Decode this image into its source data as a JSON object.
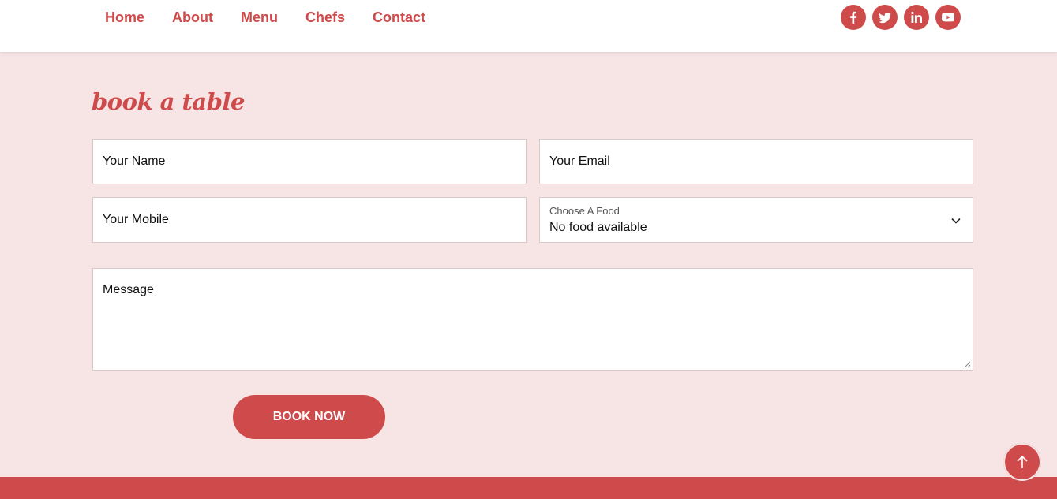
{
  "nav": {
    "items": [
      {
        "label": "Home"
      },
      {
        "label": "About"
      },
      {
        "label": "Menu"
      },
      {
        "label": "Chefs"
      },
      {
        "label": "Contact"
      }
    ]
  },
  "socials": [
    "facebook-icon",
    "twitter-icon",
    "linkedin-icon",
    "youtube-icon"
  ],
  "section": {
    "title": "book a table"
  },
  "form": {
    "name_placeholder": "Your Name",
    "email_placeholder": "Your Email",
    "mobile_placeholder": "Your Mobile",
    "food_label": "Choose A Food",
    "food_value": "No food available",
    "message_placeholder": "Message",
    "submit_label": "BOOK NOW"
  },
  "colors": {
    "accent": "#cf4a4a",
    "background": "#f7e4e5",
    "header_bg": "#ffffff"
  }
}
